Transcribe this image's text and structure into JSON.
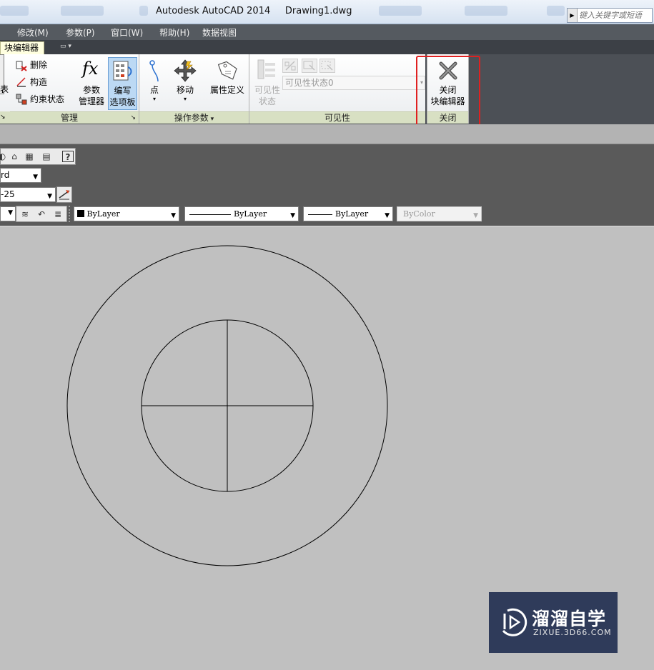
{
  "titlebar": {
    "title": "Autodesk AutoCAD 2014",
    "document": "Drawing1.dwg",
    "search_placeholder": "键入关键字或短语"
  },
  "menubar": {
    "items": [
      "修改(M)",
      "参数(P)",
      "窗口(W)",
      "帮助(H)",
      "数据视图"
    ]
  },
  "ribbon_tabs": {
    "active_tab": "块编辑器"
  },
  "ribbon": {
    "manage": {
      "title": "管理",
      "partial_label": "表",
      "delete_label": "删除",
      "construct_label": "构造",
      "constraint_state_label": "约束状态",
      "param_manager_label": [
        "参数",
        "管理器"
      ],
      "write_palette_label": [
        "编写",
        "选项板"
      ]
    },
    "action_params": {
      "title": "操作参数",
      "point_label": "点",
      "move_label": "移动",
      "attr_def_label": "属性定义"
    },
    "visibility": {
      "title": "可见性",
      "state_label": [
        "可见性",
        "状态"
      ],
      "dropdown_value": "可见性状态0"
    },
    "close": {
      "title": "关闭",
      "close_label": [
        "关闭",
        "块编辑器"
      ]
    }
  },
  "toolbars": {
    "style_combo": "rd",
    "dim_combo": "-25",
    "color_combo": "ByLayer",
    "linetype_combo": "ByLayer",
    "lineweight_combo": "ByLayer",
    "plotstyle_combo": "ByColor"
  },
  "watermark": {
    "title": "溜溜自学",
    "subtitle": "ZIXUE.3D66.COM"
  },
  "colors": {
    "highlight": "#e02020",
    "canvas": "#c0c0c0",
    "ribbon_panel_title": "#d8e0c3",
    "active_tab": "#ffffe0"
  }
}
